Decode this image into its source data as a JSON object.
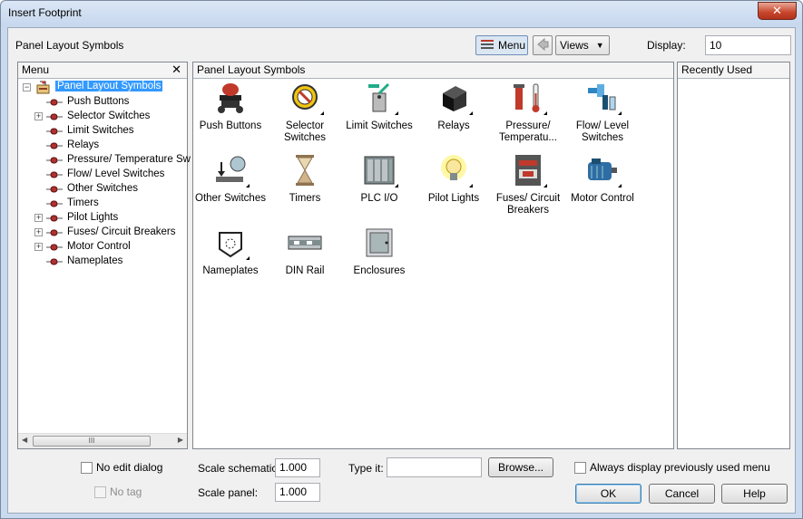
{
  "window": {
    "title": "Insert Footprint",
    "close_glyph": "✕"
  },
  "toolbar": {
    "panel_label": "Panel Layout Symbols",
    "menu_label": "Menu",
    "views_label": "Views",
    "display_label": "Display:",
    "display_value": "10"
  },
  "menu_panel": {
    "title": "Menu",
    "close_glyph": "✕",
    "root": "Panel Layout Symbols",
    "items": [
      {
        "label": "Push Buttons",
        "expandable": false
      },
      {
        "label": "Selector Switches",
        "expandable": true
      },
      {
        "label": "Limit Switches",
        "expandable": false
      },
      {
        "label": "Relays",
        "expandable": false
      },
      {
        "label": "Pressure/ Temperature Sw",
        "expandable": false
      },
      {
        "label": "Flow/ Level Switches",
        "expandable": false
      },
      {
        "label": "Other Switches",
        "expandable": false
      },
      {
        "label": "Timers",
        "expandable": false
      },
      {
        "label": "Pilot Lights",
        "expandable": true
      },
      {
        "label": "Fuses/ Circuit Breakers",
        "expandable": true
      },
      {
        "label": "Motor Control",
        "expandable": true
      },
      {
        "label": "Nameplates",
        "expandable": false
      }
    ],
    "scroll_grip": "III"
  },
  "symbols_panel": {
    "title": "Panel Layout Symbols",
    "symbols": [
      {
        "label": "Push Buttons",
        "icon": "push-button-icon",
        "more": false
      },
      {
        "label": "Selector Switches",
        "icon": "selector-switch-icon",
        "more": true
      },
      {
        "label": "Limit Switches",
        "icon": "limit-switch-icon",
        "more": true
      },
      {
        "label": "Relays",
        "icon": "relay-icon",
        "more": true
      },
      {
        "label": "Pressure/ Temperatu...",
        "icon": "pressure-temperature-icon",
        "more": true
      },
      {
        "label": "Flow/ Level Switches",
        "icon": "flow-level-icon",
        "more": true
      },
      {
        "label": "Other Switches",
        "icon": "other-switch-icon",
        "more": true
      },
      {
        "label": "Timers",
        "icon": "timer-icon",
        "more": false
      },
      {
        "label": "PLC I/O",
        "icon": "plc-io-icon",
        "more": true
      },
      {
        "label": "Pilot Lights",
        "icon": "pilot-light-icon",
        "more": true
      },
      {
        "label": "Fuses/ Circuit Breakers",
        "icon": "fuse-breaker-icon",
        "more": true
      },
      {
        "label": "Motor Control",
        "icon": "motor-control-icon",
        "more": true
      },
      {
        "label": "Nameplates",
        "icon": "nameplate-icon",
        "more": true
      },
      {
        "label": "DIN Rail",
        "icon": "din-rail-icon",
        "more": false
      },
      {
        "label": "Enclosures",
        "icon": "enclosure-icon",
        "more": false
      }
    ]
  },
  "recent_panel": {
    "title": "Recently Used"
  },
  "footer": {
    "no_edit_dialog": "No edit dialog",
    "no_tag": "No tag",
    "scale_schematic_label": "Scale schematic:",
    "scale_schematic_value": "1.000",
    "scale_panel_label": "Scale panel:",
    "scale_panel_value": "1.000",
    "type_it_label": "Type it:",
    "type_it_value": "",
    "browse_label": "Browse...",
    "always_display_label": "Always display previously used menu",
    "ok_label": "OK",
    "cancel_label": "Cancel",
    "help_label": "Help"
  }
}
